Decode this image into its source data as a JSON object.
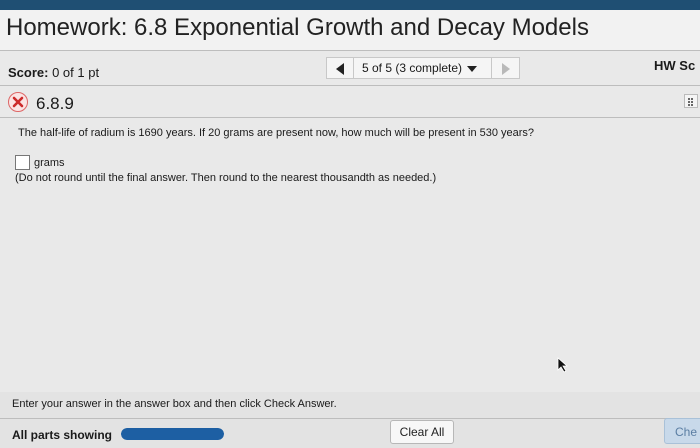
{
  "header": {
    "title": "Homework: 6.8 Exponential Growth and Decay Models"
  },
  "score": {
    "label": "Score:",
    "value": "0 of 1 pt"
  },
  "navigation": {
    "position": "5 of 5 (3 complete)"
  },
  "hw_score": {
    "label": "HW Sc"
  },
  "question": {
    "number": "6.8.9",
    "text": "The half-life of radium is 1690 years. If 20 grams are present now, how much will be present in 530 years?",
    "answer_value": "",
    "unit": "grams",
    "instruction": "(Do not round until the final answer. Then round to the nearest thousandth as needed.)"
  },
  "footer": {
    "instruction": "Enter your answer in the answer box and then click Check Answer.",
    "parts_label": "All parts showing",
    "progress_fraction": 1.0,
    "clear_label": "Clear All",
    "check_label": "Che"
  },
  "colors": {
    "topbar": "#1f4f73",
    "progress": "#1d5fa3",
    "incorrect": "#cc2a2a"
  },
  "icons": {
    "status": "x-circle-icon",
    "prev": "triangle-left-icon",
    "next": "triangle-right-icon",
    "menu": "caret-down-icon",
    "grid": "grid-icon",
    "cursor": "pointer-cursor-icon"
  }
}
